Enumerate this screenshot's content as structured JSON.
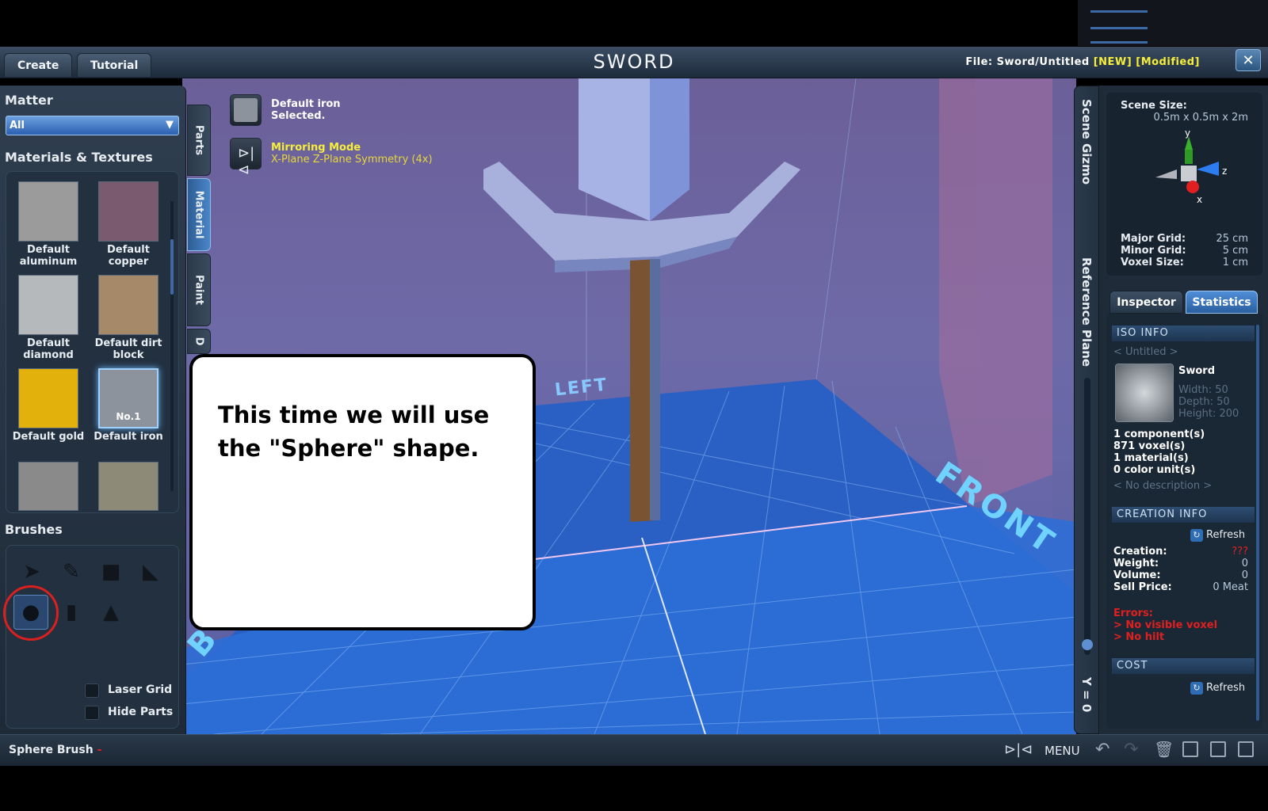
{
  "window": {
    "title": "SWORD",
    "menu_tabs": [
      "Create",
      "Tutorial"
    ],
    "file_label": "File:",
    "file_path": "Sword/Untitled",
    "file_new": "[NEW]",
    "file_modified": "[Modified]",
    "close_glyph": "✕"
  },
  "left_panel": {
    "matter_title": "Matter",
    "matter_value": "All",
    "materials_title": "Materials & Textures",
    "materials": [
      {
        "name": "Default aluminum",
        "color": "#9b9b9b"
      },
      {
        "name": "Default copper",
        "color": "#7a5a6e"
      },
      {
        "name": "Default diamond",
        "color": "#b6b9bc"
      },
      {
        "name": "Default dirt block",
        "color": "#a58968"
      },
      {
        "name": "Default gold",
        "color": "#e3b10c"
      },
      {
        "name": "Default iron",
        "color": "#8d939c"
      }
    ],
    "selected_badge": "No.1",
    "brushes_title": "Brushes",
    "brushes": [
      "select-arrow",
      "pencil",
      "cube",
      "wedge",
      "sphere",
      "cylinder",
      "cone"
    ],
    "options": [
      {
        "label": "Laser Grid"
      },
      {
        "label": "Hide Parts"
      }
    ]
  },
  "vertical_tabs": [
    "Parts",
    "Material",
    "Paint",
    "D"
  ],
  "viewport": {
    "selection_line1": "Default iron",
    "selection_line2": "Selected.",
    "mode_title": "Mirroring Mode",
    "mode_desc": "X-Plane Z-Plane Symmetry (4x)",
    "label_left": "LEFT",
    "label_front": "FRONT",
    "label_back": "B"
  },
  "callout": {
    "text": "This time we will use the \"Sphere\" shape."
  },
  "right_panel": {
    "strip_scene_gizmo": "Scene Gizmo",
    "strip_reference_plane": "Reference Plane",
    "strip_y_value": "Y = 0",
    "scene_size_label": "Scene Size:",
    "scene_size_value": "0.5m x 0.5m x 2m",
    "axis_y": "y",
    "axis_z": "z",
    "axis_x": "x",
    "grid": [
      {
        "label": "Major Grid:",
        "value": "25 cm"
      },
      {
        "label": "Minor Grid:",
        "value": "5 cm"
      },
      {
        "label": "Voxel Size:",
        "value": "1 cm"
      }
    ],
    "tabs": [
      "Inspector",
      "Statistics"
    ],
    "iso_head": "ISO INFO",
    "iso_name_placeholder": "< Untitled >",
    "iso_item": "Sword",
    "iso_dims": [
      "Width: 50",
      "Depth: 50",
      "Height: 200"
    ],
    "stats": [
      "1 component(s)",
      "871 voxel(s)",
      "1 material(s)",
      "0 color unit(s)"
    ],
    "no_desc": "< No description >",
    "creation_head": "CREATION INFO",
    "refresh_label": "Refresh",
    "creation_rows": [
      {
        "label": "Creation:",
        "value": "???"
      },
      {
        "label": "Weight:",
        "value": "0"
      },
      {
        "label": "Volume:",
        "value": "0"
      },
      {
        "label": "Sell Price:",
        "value": "0 Meat"
      }
    ],
    "errors_title": "Errors:",
    "errors": [
      "> No visible voxel",
      "> No hilt"
    ],
    "cost_head": "COST"
  },
  "bottom_bar": {
    "brush_status": "Sphere Brush",
    "brush_dash": "-",
    "menu_label": "MENU"
  }
}
